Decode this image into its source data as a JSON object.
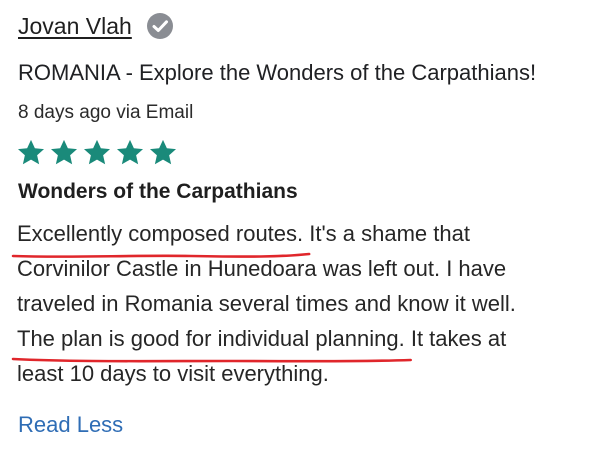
{
  "reviewer": {
    "name": "Jovan Vlah",
    "verified_icon": "check-badge-icon"
  },
  "trip": {
    "title": "ROMANIA - Explore the Wonders of the Carpathians!"
  },
  "meta": {
    "posted": "8 days ago via Email"
  },
  "rating": {
    "value": 5,
    "max": 5,
    "color": "#1a8a7a"
  },
  "review": {
    "title": "Wonders of the Carpathians",
    "line1_marked": "Excellently composed routes.",
    "line1_rest": " It's a shame that",
    "line2": "Corvinilor Castle in Hunedoara was left out. I have",
    "line3": "traveled in Romania several times and know it well.",
    "line4_marked": "The plan is good for individual planning.",
    "line4_rest": " It takes at",
    "line5": "least 10 days to visit everything.",
    "annotation_color": "#e0262b"
  },
  "actions": {
    "read_less_label": "Read Less",
    "link_color": "#2f6db5"
  }
}
